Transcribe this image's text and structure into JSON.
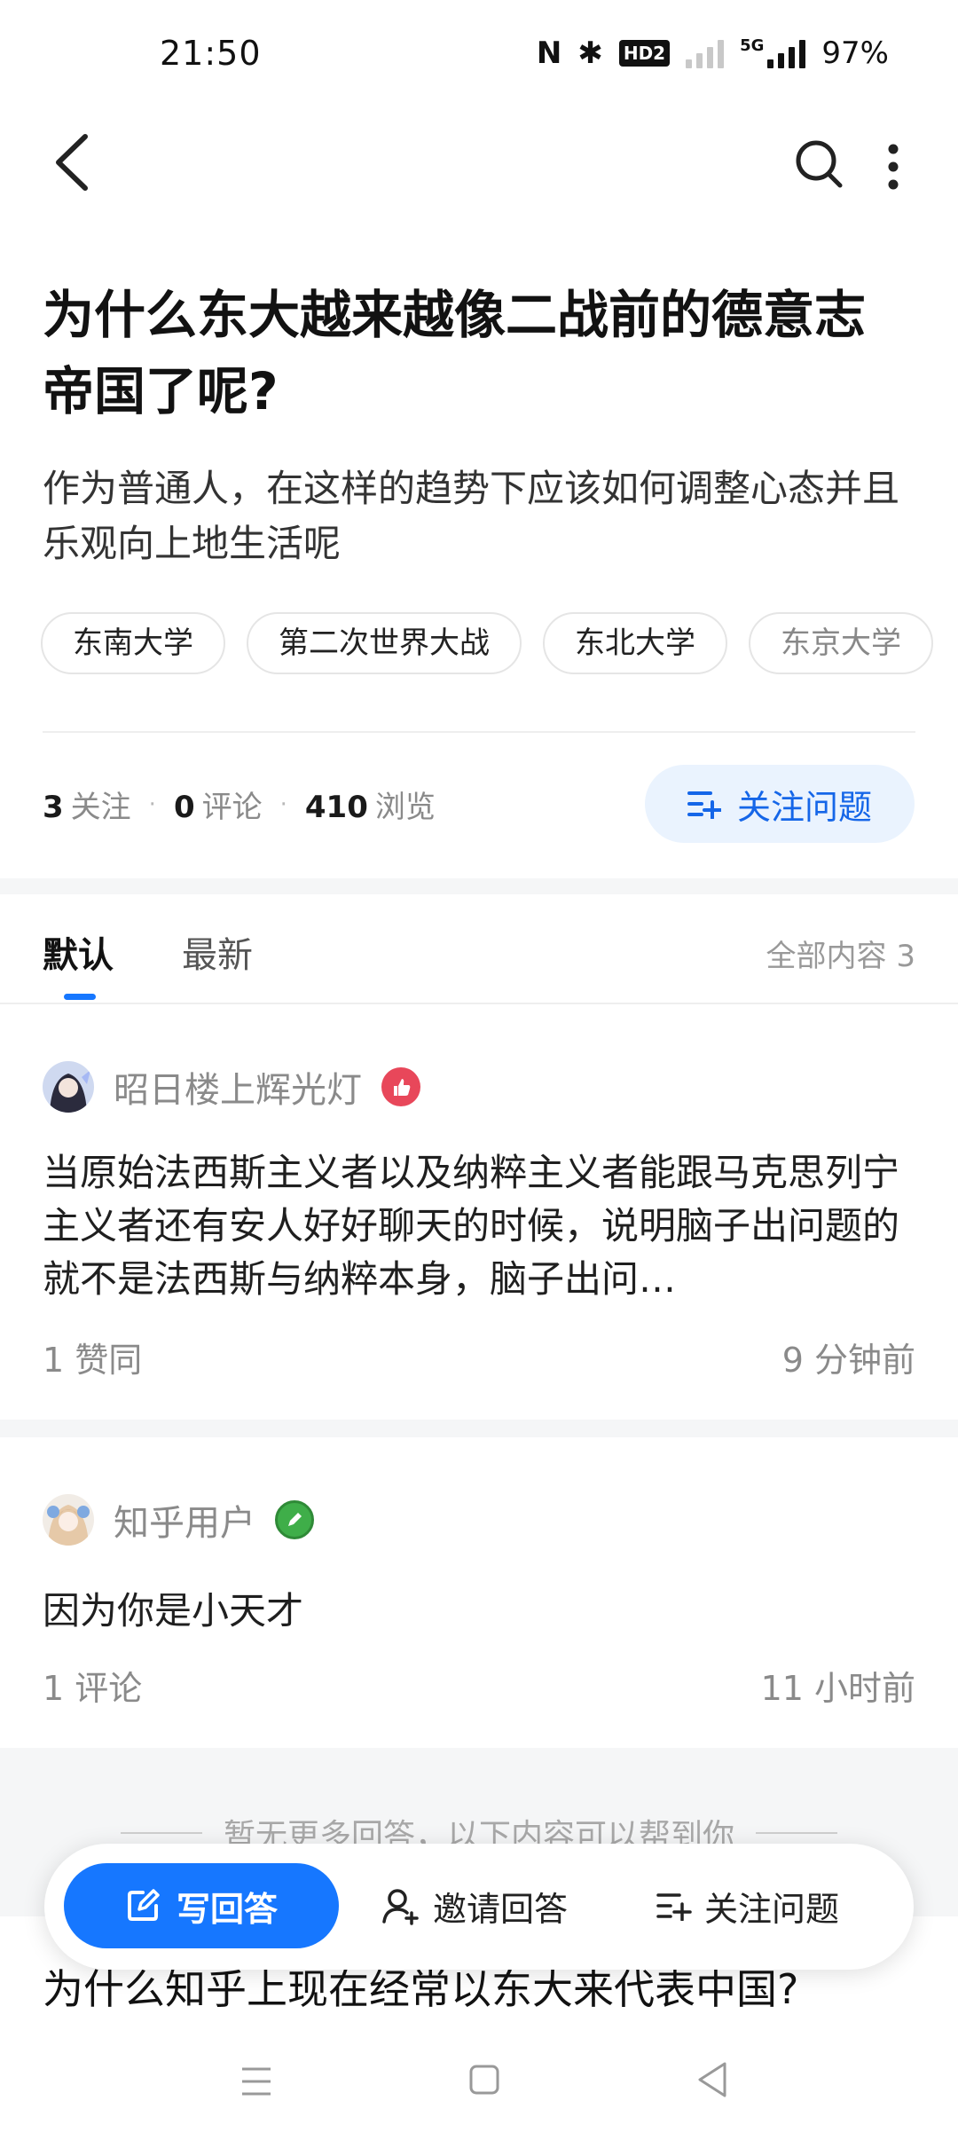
{
  "status_bar": {
    "time": "21:50",
    "battery": "97%",
    "hd_label": "HD2",
    "net_label": "5G"
  },
  "question": {
    "title": "为什么东大越来越像二战前的德意志帝国了呢?",
    "detail": "作为普通人，在这样的趋势下应该如何调整心态并且乐观向上地生活呢",
    "tags": [
      "东南大学",
      "第二次世界大战",
      "东北大学",
      "东京大学"
    ]
  },
  "stats": {
    "followers_count": "3",
    "followers_label": "关注",
    "comments_count": "0",
    "comments_label": "评论",
    "views_count": "410",
    "views_label": "浏览",
    "separator": "·"
  },
  "follow_button": {
    "label": "关注问题"
  },
  "tabs": {
    "default": "默认",
    "latest": "最新",
    "total": "全部内容 3"
  },
  "answers": [
    {
      "author": "昭日楼上辉光灯",
      "text": "当原始法西斯主义者以及纳粹主义者能跟马克思列宁主义者还有安人好好聊天的时候，说明脑子出问题的就不是法西斯与纳粹本身，脑子出问…",
      "meta_left": "1 赞同",
      "meta_right": "9 分钟前",
      "badge_color": "#e8475a"
    },
    {
      "author": "知乎用户",
      "text": "因为你是小天才",
      "meta_left": "1 评论",
      "meta_right": "11 小时前",
      "badge_color": "#3fae49"
    }
  ],
  "more_hint": "暂无更多回答，以下内容可以帮到你",
  "bottom_bar": {
    "write": "写回答",
    "invite": "邀请回答",
    "follow": "关注问题"
  },
  "related": {
    "title": "为什么知乎上现在经常以东大来代表中国?"
  },
  "colors": {
    "accent": "#1677ff",
    "accent_bg": "#eaf3fe"
  }
}
